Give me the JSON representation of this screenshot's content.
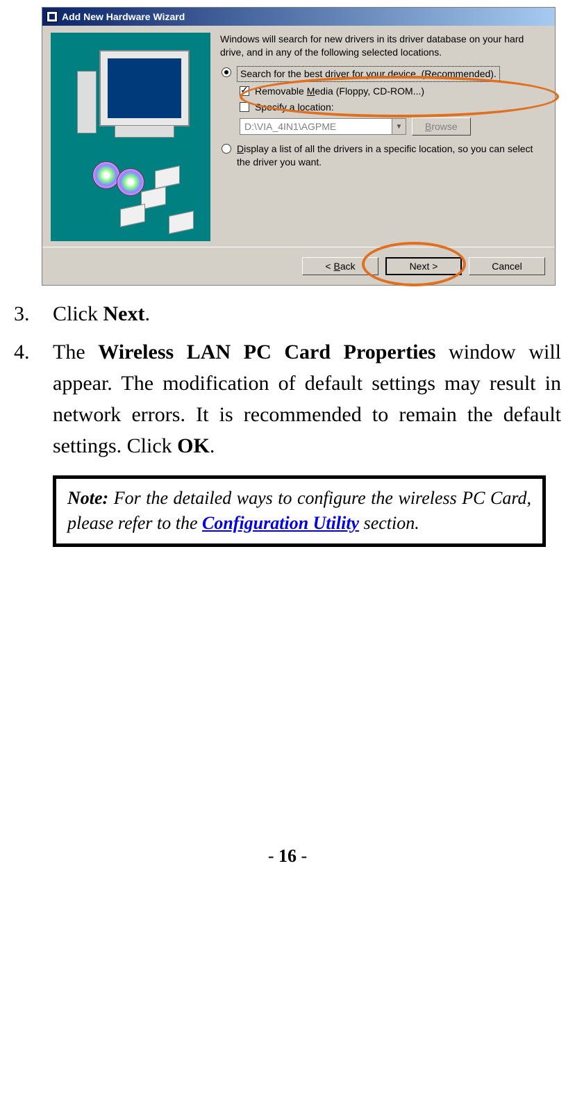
{
  "dialog": {
    "title": "Add New Hardware Wizard",
    "info": "Windows will search for new drivers in its driver database on your hard drive, and in any of the following selected locations.",
    "option_search": "Search for the best driver for your device. (Recommended).",
    "check_removable_pre": "Removable ",
    "check_removable_u": "M",
    "check_removable_post": "edia (Floppy, CD-ROM...)",
    "check_specify_pre": "Specify a ",
    "check_specify_u": "l",
    "check_specify_post": "ocation:",
    "path_value": "D:\\VIA_4IN1\\AGPME",
    "browse_u": "B",
    "browse_post": "rowse",
    "option_display_u": "D",
    "option_display_post": "isplay a list of all the drivers in a specific location, so you can select the driver you want.",
    "back_pre": "< ",
    "back_u": "B",
    "back_post": "ack",
    "next": "Next >",
    "cancel": "Cancel"
  },
  "steps": {
    "s3_num": "3.",
    "s3_pre": "Click ",
    "s3_bold": "Next",
    "s3_post": ".",
    "s4_num": "4.",
    "s4_pre": "The ",
    "s4_bold1": "Wireless LAN PC Card Properties",
    "s4_mid": " window will appear.  The modification of default settings may result in network errors.  It is recommended to remain the default settings.   Click ",
    "s4_bold2": "OK",
    "s4_post": "."
  },
  "note": {
    "label": "Note:",
    "pre": " For the detailed ways to configure the wireless PC Card, please refer to the ",
    "link": "Configuration Utility",
    "post": " section."
  },
  "page": {
    "dashL": "- ",
    "num": "16",
    "dashR": " -"
  }
}
